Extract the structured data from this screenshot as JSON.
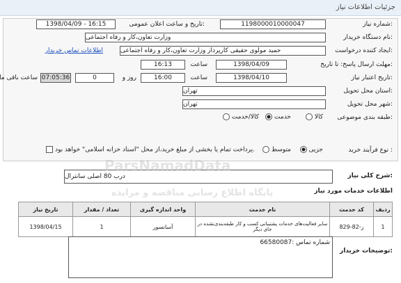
{
  "header": {
    "title": "جزئیات اطلاعات نیاز"
  },
  "fields": {
    "need_number_label": "شماره نیاز:",
    "need_number": "1198000010000047",
    "announce_label": "تاریخ و ساعت اعلان عمومی:",
    "announce_value": "1398/04/09 - 16:15",
    "buyer_org_label": "نام دستگاه خریدار:",
    "buyer_org": "وزارت تعاون،کار و رفاه اجتماعی",
    "requester_label": "ایجاد کننده درخواست:",
    "requester": "حمید  مولوی حقیقی کارپرداز وزارت تعاون،کار و رفاه اجتماعی",
    "buyer_contact_link": "اطلاعات تماس خریدار",
    "reply_deadline_label": "مهلت ارسال پاسخ: تا تاریخ:",
    "reply_date": "1398/04/09",
    "hour_label": "ساعت",
    "reply_hour": "16:13",
    "validity_label": "تاریخ اعتبار نیاز:",
    "validity_date": "1398/04/10",
    "validity_hour": "16:00",
    "day_label": "روز و",
    "days": "0",
    "remaining_time": "07:05:36",
    "remaining_label": "ساعت باقی مانده",
    "province_label": "استان محل تحویل:",
    "province": "تهران",
    "city_label": "شهر محل تحویل:",
    "city": "تهران",
    "category_label": "طبقه بندی موضوعی:",
    "category_options": [
      "کالا",
      "خدمت",
      "کالا/خدمت"
    ],
    "purchase_label": "نوع فرآیند خرید :",
    "purchase_options": [
      "جزیی",
      "متوسط"
    ],
    "payment_note": "پرداخت تمام یا بخشی از مبلغ خرید،از محل \"اسناد خزانه اسلامی\" خواهد بود."
  },
  "summary": {
    "label": "شرح کلی نیاز:",
    "value": "درب 80 اصلی سانترال"
  },
  "services": {
    "title": "اطلاعات خدمات مورد نیاز",
    "columns": [
      "ردیف",
      "کد خدمت",
      "نام خدمت",
      "واحد اندازه گیری",
      "تعداد / مقدار",
      "تاریخ نیاز"
    ],
    "rows": [
      [
        "1",
        "ز-82-829",
        "سایر فعالیت‌های خدمات پشتیبانی کسب و کار طبقه‌بندی‌نشده در جای دیگر",
        "آسانسور",
        "1",
        "1398/04/15"
      ]
    ]
  },
  "buyer_notes": {
    "label": "توضیحات خریدار:",
    "value": "شماره تماس :66580087"
  },
  "watermark": {
    "line1": "ParsNamadData",
    "line2": "پایگاه اطلاع رسانی مناقصه و مزایده"
  },
  "colors": {
    "link": "#1a4fbf",
    "timer_bg": "#d9d9d9"
  }
}
